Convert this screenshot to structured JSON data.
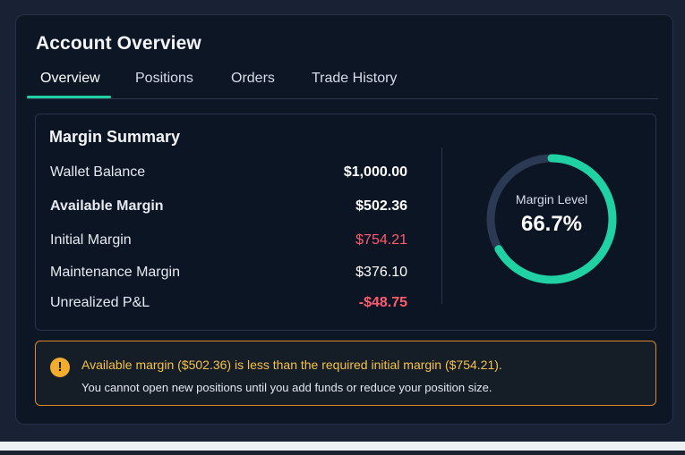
{
  "header": {
    "title": "Account Overview"
  },
  "tabs": [
    {
      "label": "Overview",
      "active": true
    },
    {
      "label": "Positions",
      "active": false
    },
    {
      "label": "Orders",
      "active": false
    },
    {
      "label": "Trade History",
      "active": false
    }
  ],
  "margin_summary": {
    "title": "Margin Summary",
    "rows": [
      {
        "label": "Wallet Balance",
        "value": "$1,000.00",
        "status": "normal"
      },
      {
        "label": "Available Margin",
        "value": "$502.36",
        "status": "normal"
      },
      {
        "label": "Initial Margin",
        "value": "$754.21",
        "status": "negative"
      },
      {
        "label": "Maintenance Margin",
        "value": "$376.10",
        "status": "normal"
      },
      {
        "label": "Unrealized P&L",
        "value": "-$48.75",
        "status": "negative"
      }
    ],
    "gauge": {
      "label": "Margin Level",
      "value_text": "66.7%",
      "fraction": 0.667
    }
  },
  "alert": {
    "icon": "exclamation-icon",
    "primary": "Available margin ($502.36) is less than the required initial margin ($754.21).",
    "secondary": "You cannot open new positions until you add funds or reduce your position size."
  },
  "colors": {
    "accent": "#1fd1a3",
    "gauge_track": "#2b3a52",
    "negative": "#ff5b6e",
    "warning": "#f2ad2f",
    "warning_border": "#d9892d"
  }
}
